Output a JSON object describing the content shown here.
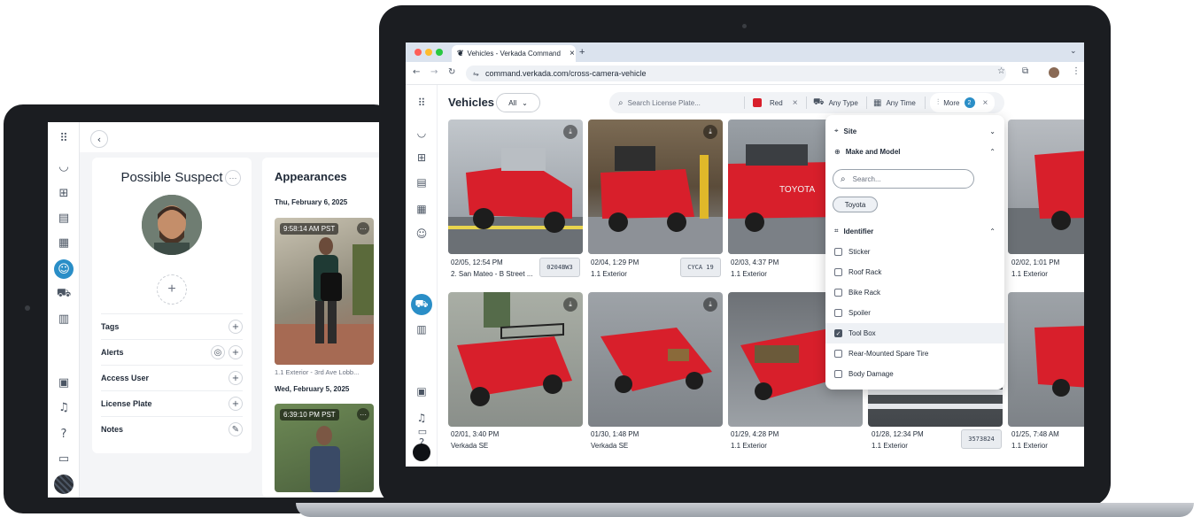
{
  "tablet": {
    "suspect_title": "Possible Suspect",
    "more_glyph": "···",
    "rows": [
      {
        "label": "Tags",
        "icons": [
          "+"
        ]
      },
      {
        "label": "Alerts",
        "icons": [
          "◎",
          "+"
        ]
      },
      {
        "label": "Access User",
        "icons": [
          "+"
        ]
      },
      {
        "label": "License Plate",
        "icons": [
          "+"
        ]
      },
      {
        "label": "Notes",
        "icons": [
          "✎"
        ]
      }
    ],
    "appearances_title": "Appearances",
    "groups": [
      {
        "date": "Thu, February 6, 2025",
        "time": "9:58:14 AM PST",
        "caption": "1.1 Exterior - 3rd Ave Lobb..."
      },
      {
        "date": "Wed, February 5, 2025",
        "time": "6:39:10 PM PST",
        "caption": ""
      }
    ]
  },
  "browser": {
    "tab_title": "Vehicles - Verkada Command",
    "tab_close": "×",
    "new_tab": "+",
    "url": "command.verkada.com/cross-camera-vehicle"
  },
  "page": {
    "title": "Vehicles",
    "scope_dropdown": "All",
    "search_placeholder": "Search License Plate...",
    "filters": {
      "color": "Red",
      "color_swatch": "#d81f2b",
      "type": "Any Type",
      "time": "Any Time",
      "more": "More",
      "more_count": "2"
    },
    "tiles": [
      {
        "caption_time": "02/05, 12:54 PM",
        "caption_loc": "2. San Mateo - B Street ...",
        "plate": "0204BW3"
      },
      {
        "caption_time": "02/04, 1:29 PM",
        "caption_loc": "1.1 Exterior",
        "plate": "CYCA 19"
      },
      {
        "caption_time": "02/03, 4:37 PM",
        "caption_loc": "1.1 Exterior",
        "plate": ""
      },
      {
        "caption_time": "",
        "caption_loc": "",
        "plate": ""
      },
      {
        "caption_time": "02/02, 1:01 PM",
        "caption_loc": "1.1 Exterior",
        "plate": ""
      },
      {
        "caption_time": "02/01, 3:40 PM",
        "caption_loc": "Verkada SE",
        "plate": ""
      },
      {
        "caption_time": "01/30, 1:48 PM",
        "caption_loc": "Verkada SE",
        "plate": ""
      },
      {
        "caption_time": "01/29, 4:28 PM",
        "caption_loc": "1.1 Exterior",
        "plate": ""
      },
      {
        "caption_time": "01/28, 12:34 PM",
        "caption_loc": "1.1 Exterior",
        "plate": "3573824"
      },
      {
        "caption_time": "01/25, 7:48 AM",
        "caption_loc": "1.1 Exterior",
        "plate": ""
      }
    ]
  },
  "filter_panel": {
    "site_label": "Site",
    "make_model_label": "Make and Model",
    "search_placeholder": "Search...",
    "selected_make": "Toyota",
    "identifier_label": "Identifier",
    "options": [
      {
        "label": "Sticker",
        "checked": false
      },
      {
        "label": "Roof Rack",
        "checked": false
      },
      {
        "label": "Bike Rack",
        "checked": false
      },
      {
        "label": "Spoiler",
        "checked": false
      },
      {
        "label": "Tool Box",
        "checked": true
      },
      {
        "label": "Rear-Mounted Spare Tire",
        "checked": false
      },
      {
        "label": "Body Damage",
        "checked": false
      }
    ]
  },
  "colors": {
    "accent": "#2a8ec7",
    "truck_red": "#d81f2b"
  }
}
